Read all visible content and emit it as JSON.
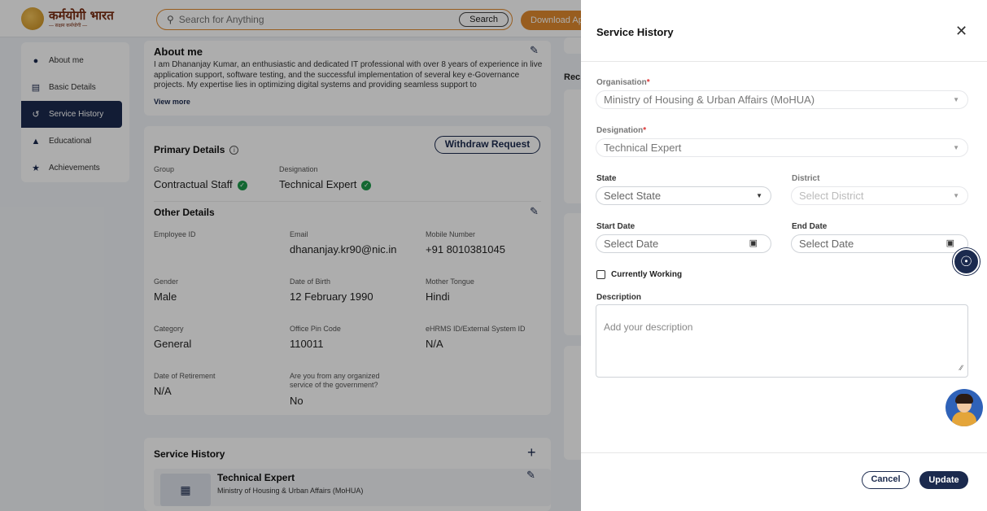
{
  "header": {
    "logo_text": "कर्मयोगी भारत",
    "logo_sub": "— सक्षम कर्मयोगी —",
    "search_placeholder": "Search for Anything",
    "search_button": "Search",
    "download_button": "Download Ap"
  },
  "sidebar": {
    "items": [
      {
        "label": "About me",
        "icon": "person-icon"
      },
      {
        "label": "Basic Details",
        "icon": "id-card-icon"
      },
      {
        "label": "Service History",
        "icon": "history-icon",
        "active": true
      },
      {
        "label": "Educational",
        "icon": "graduation-cap-icon"
      },
      {
        "label": "Achievements",
        "icon": "trophy-icon"
      }
    ]
  },
  "about": {
    "title": "About me",
    "text": "I am Dhananjay Kumar, an enthusiastic and dedicated IT professional with over 8 years of experience in live application support, software testing, and the successful implementation of several key e-Governance projects. My expertise lies in optimizing digital systems and providing seamless support to",
    "view_more": "View more"
  },
  "right_column_label": "Rec",
  "primary_details": {
    "title": "Primary Details",
    "withdraw_button": "Withdraw Request",
    "group_label": "Group",
    "group_value": "Contractual Staff",
    "designation_label": "Designation",
    "designation_value": "Technical Expert"
  },
  "other_details": {
    "title": "Other Details",
    "fields": {
      "employee_id": {
        "label": "Employee ID",
        "value": ""
      },
      "email": {
        "label": "Email",
        "value": "dhananjay.kr90@nic.in"
      },
      "mobile": {
        "label": "Mobile Number",
        "value": "+91 8010381045"
      },
      "gender": {
        "label": "Gender",
        "value": "Male"
      },
      "dob": {
        "label": "Date of Birth",
        "value": "12 February 1990"
      },
      "mother_tongue": {
        "label": "Mother Tongue",
        "value": "Hindi"
      },
      "category": {
        "label": "Category",
        "value": "General"
      },
      "pin": {
        "label": "Office Pin Code",
        "value": "110011"
      },
      "ehrms": {
        "label": "eHRMS ID/External System ID",
        "value": "N/A"
      },
      "retirement": {
        "label": "Date of Retirement",
        "value": "N/A"
      },
      "organized_line1": {
        "label": "Are you from any organized"
      },
      "organized_line2": {
        "label": "service of the government?",
        "value": "No"
      }
    }
  },
  "service_history_card": {
    "title": "Service History",
    "item_title": "Technical Expert",
    "item_subtitle": "Ministry of Housing & Urban Affairs (MoHUA)"
  },
  "panel": {
    "title": "Service History",
    "organisation": {
      "label": "Organisation",
      "value": "Ministry of Housing & Urban Affairs (MoHUA)"
    },
    "designation": {
      "label": "Designation",
      "value": "Technical Expert"
    },
    "state": {
      "label": "State",
      "placeholder": "Select State"
    },
    "district": {
      "label": "District",
      "placeholder": "Select District"
    },
    "start_date": {
      "label": "Start Date",
      "placeholder": "Select Date"
    },
    "end_date": {
      "label": "End Date",
      "placeholder": "Select Date"
    },
    "currently_working": "Currently Working",
    "description": {
      "label": "Description",
      "placeholder": "Add your description"
    },
    "cancel_button": "Cancel",
    "update_button": "Update",
    "required_mark": "*"
  },
  "colors": {
    "primary": "#1b2a4e",
    "accent": "#e08a2e",
    "success": "#1d9a4a"
  }
}
